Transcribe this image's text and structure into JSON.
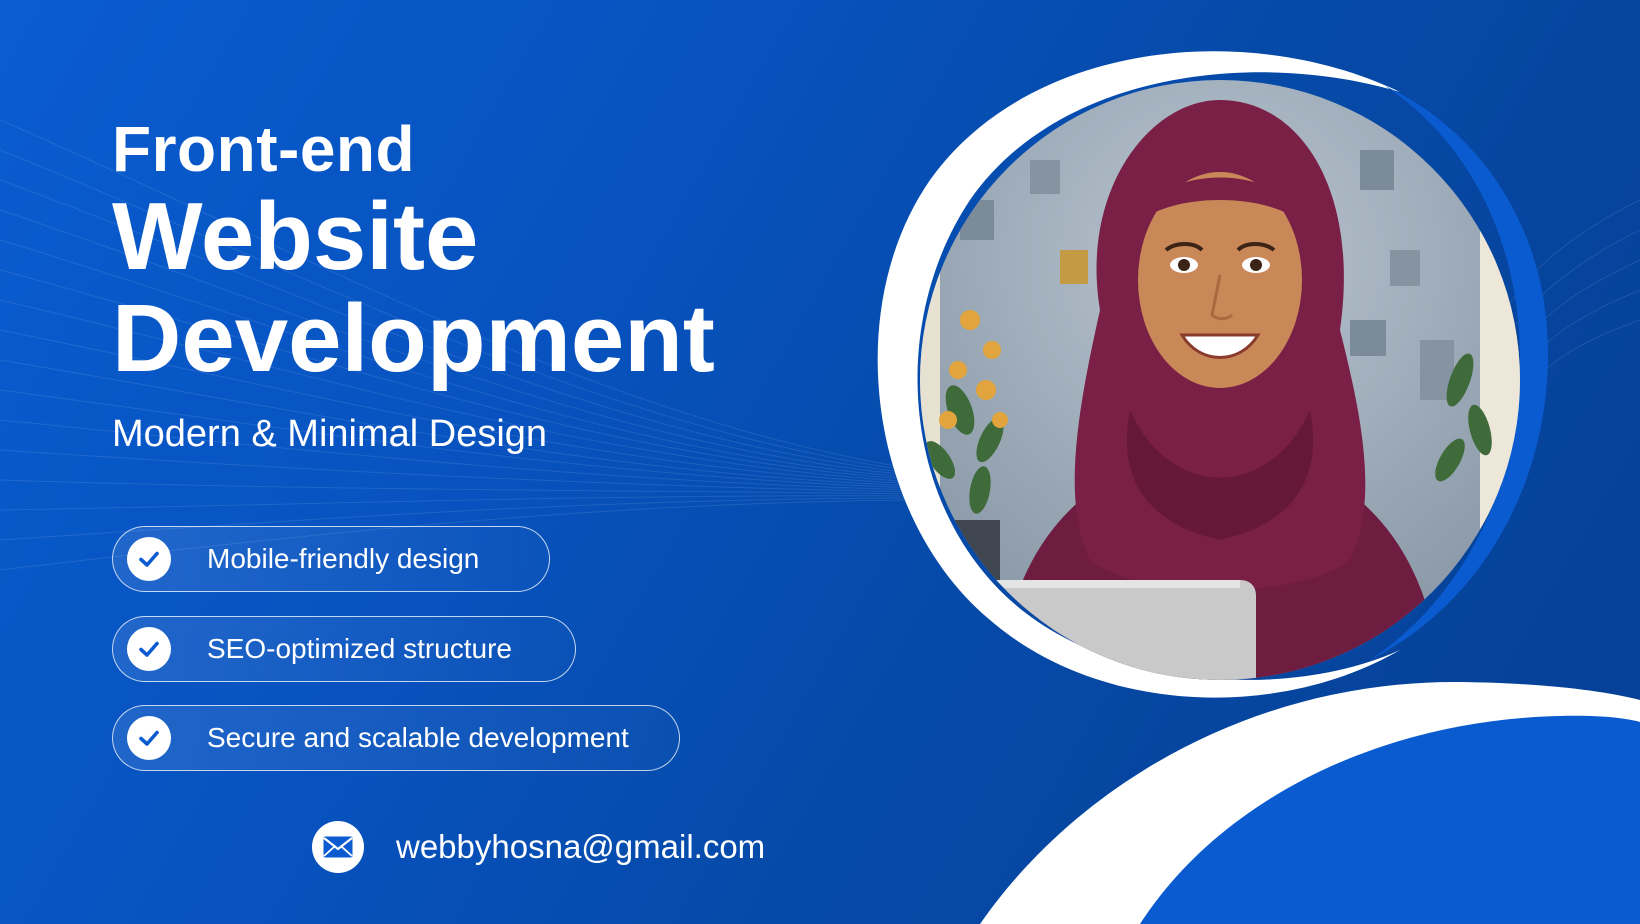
{
  "headline": {
    "line1": "Front-end",
    "line2": "Website",
    "line3": "Development"
  },
  "subtitle": "Modern & Minimal Design",
  "features": [
    {
      "label": "Mobile-friendly design",
      "icon": "check-circle-icon"
    },
    {
      "label": "SEO-optimized structure",
      "icon": "check-circle-icon"
    },
    {
      "label": "Secure and scalable development",
      "icon": "check-circle-icon"
    }
  ],
  "contact": {
    "icon": "envelope-icon",
    "email": "webbyhosna@gmail.com"
  },
  "portrait": {
    "subject": "illustration of a smiling woman in a maroon hijab with a laptop",
    "colors": {
      "hijab": "#7a1f45",
      "skin": "#c98858",
      "background": "#9aa7b5"
    }
  },
  "colors": {
    "background_start": "#0a5cd0",
    "background_end": "#053f93",
    "accent_white": "#ffffff",
    "check_blue": "#0b5bd0"
  }
}
